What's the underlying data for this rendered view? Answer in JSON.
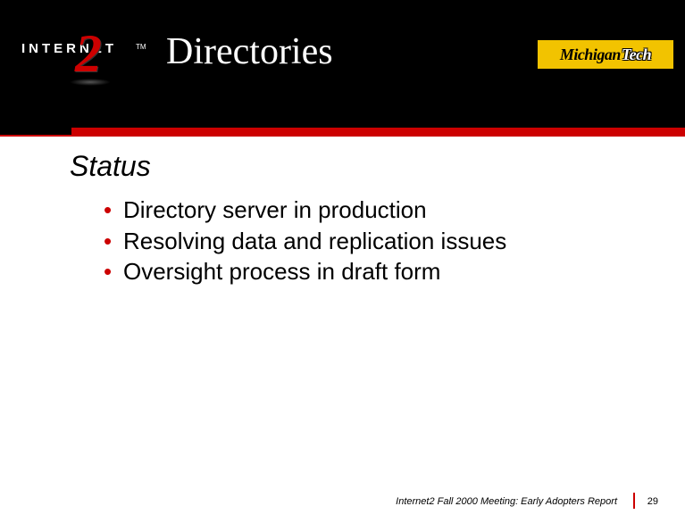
{
  "header": {
    "logo_left": {
      "word": "INTERNET",
      "number": "2",
      "tm": "TM"
    },
    "title": "Directories",
    "logo_right": {
      "part1": "Michigan",
      "part2": "Tech"
    }
  },
  "content": {
    "subtitle": "Status",
    "bullets": [
      "Directory server in production",
      "Resolving data and replication issues",
      "Oversight process in draft form"
    ]
  },
  "footer": {
    "text": "Internet2 Fall 2000 Meeting: Early Adopters Report",
    "page": "29"
  },
  "colors": {
    "accent_red": "#cc0000",
    "accent_gold": "#f2c300",
    "black": "#000000",
    "white": "#ffffff"
  }
}
